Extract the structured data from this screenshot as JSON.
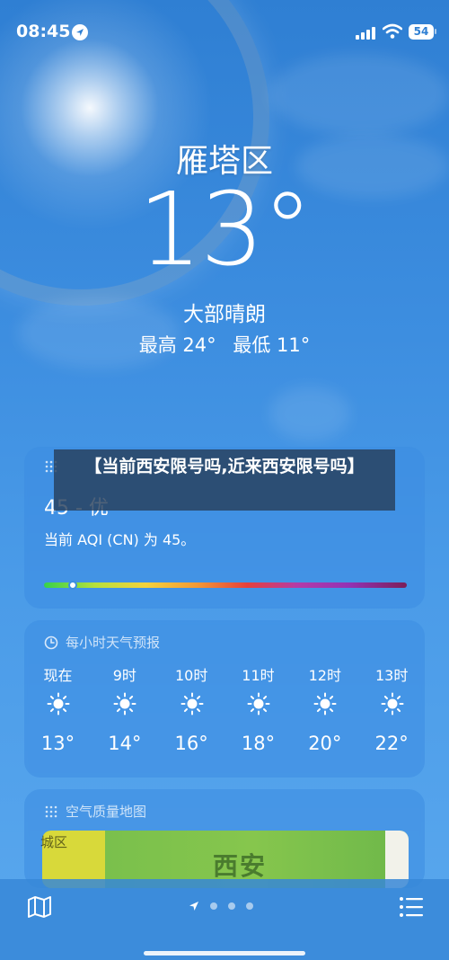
{
  "status_bar": {
    "time": "08:45",
    "battery": "54",
    "location_icon": "location-arrow-icon",
    "signal_icon": "cellular-signal-icon",
    "wifi_icon": "wifi-icon"
  },
  "weather": {
    "location": "雁塔区",
    "temperature": "13°",
    "condition": "大部晴朗",
    "high": "最高 24°",
    "low": "最低 11°"
  },
  "banner": {
    "text": "【当前西安限号吗,近来西安限号吗】"
  },
  "aqi": {
    "value": "45 - 优",
    "description": "当前 AQI (CN) 为 45。",
    "level": 0.08
  },
  "hourly": {
    "title": "每小时天气预报",
    "hours": [
      {
        "label": "现在",
        "temp": "13°",
        "icon": "sun-icon"
      },
      {
        "label": "9时",
        "temp": "14°",
        "icon": "sun-icon"
      },
      {
        "label": "10时",
        "temp": "16°",
        "icon": "sun-icon"
      },
      {
        "label": "11时",
        "temp": "18°",
        "icon": "sun-icon"
      },
      {
        "label": "12时",
        "temp": "20°",
        "icon": "sun-icon"
      },
      {
        "label": "13时",
        "temp": "22°",
        "icon": "sun-icon"
      }
    ]
  },
  "air_map": {
    "title": "空气质量地图",
    "city_label": "西安",
    "district_label": "城区"
  },
  "colors": {
    "sky_top": "#2f7fd3",
    "card_bg": "rgba(60,140,225,0.55)",
    "banner_bg": "#28405c"
  }
}
